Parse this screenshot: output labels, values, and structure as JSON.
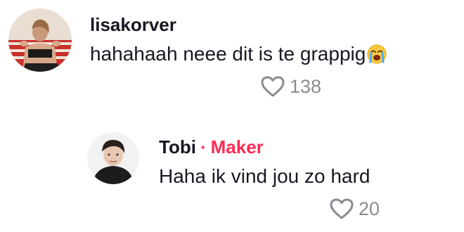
{
  "comments": [
    {
      "username": "lisakorver",
      "text": "hahahaah neee dit is te grappig",
      "emoji": "loudly-crying-face",
      "like_count": "138",
      "avatar_icon": "user-photo-avatar"
    }
  ],
  "reply": {
    "username": "Tobi",
    "separator": "·",
    "creator_label": "Maker",
    "text": "Haha ik vind jou zo hard",
    "like_count": "20",
    "avatar_icon": "user-photo-avatar"
  },
  "colors": {
    "text": "#161823",
    "muted": "#8a8b91",
    "accent": "#fe2c55"
  }
}
